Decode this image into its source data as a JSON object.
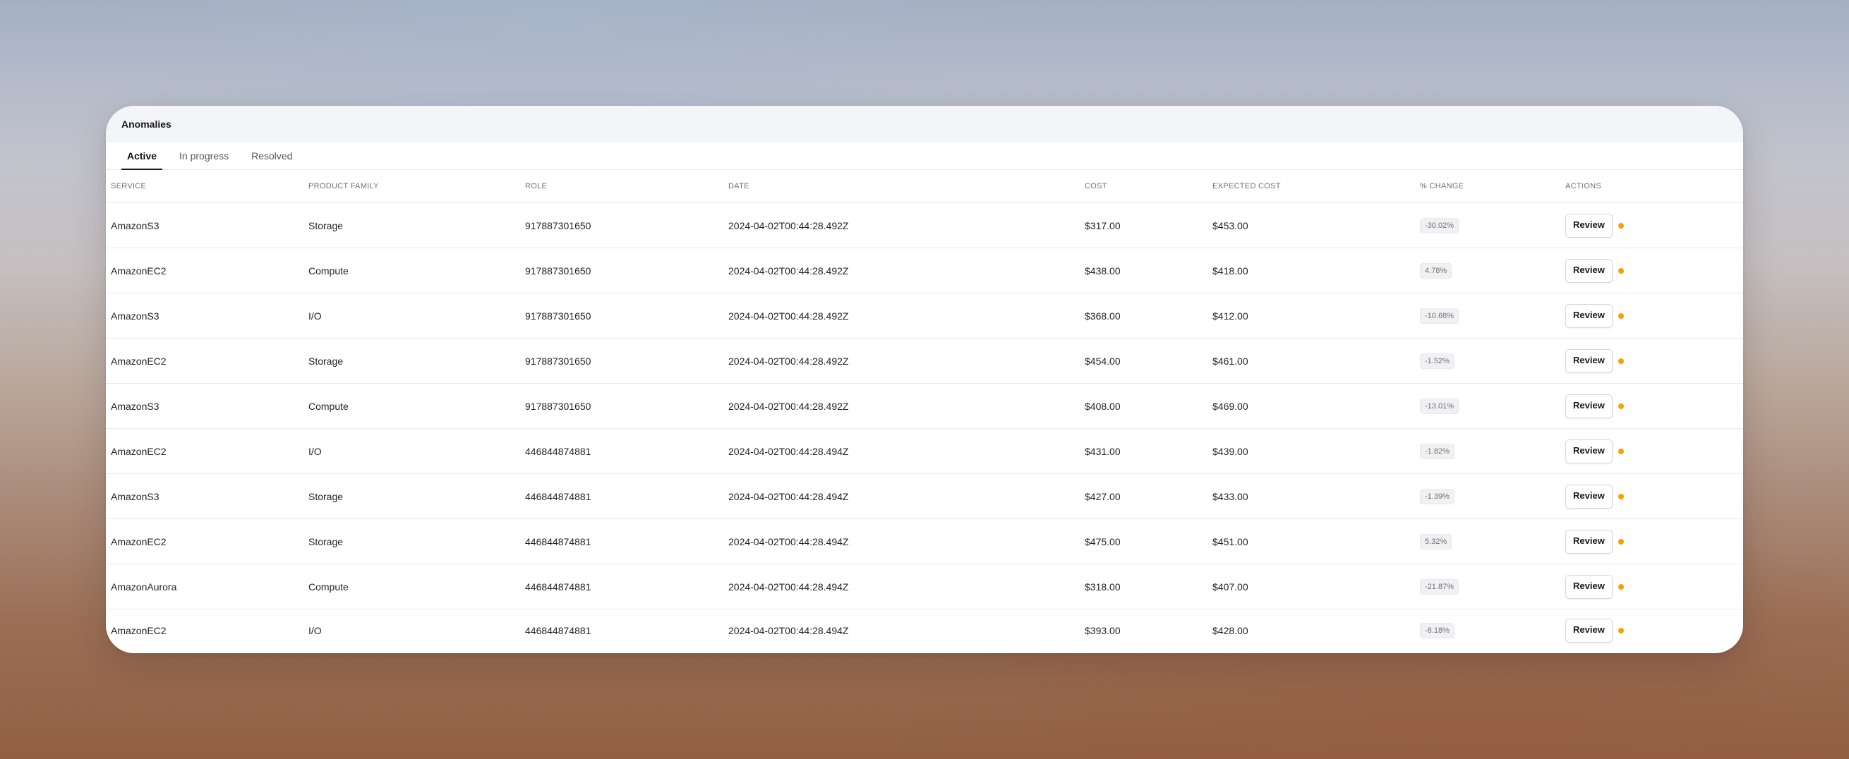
{
  "header": {
    "title": "Anomalies"
  },
  "tabs": [
    {
      "label": "Active",
      "active": true
    },
    {
      "label": "In progress",
      "active": false
    },
    {
      "label": "Resolved",
      "active": false
    }
  ],
  "table": {
    "columns": [
      "SERVICE",
      "PRODUCT FAMILY",
      "ROLE",
      "DATE",
      "COST",
      "EXPECTED COST",
      "% CHANGE",
      "ACTIONS"
    ],
    "action_label": "Review",
    "status_color": "#f5a300",
    "rows": [
      {
        "service": "AmazonS3",
        "family": "Storage",
        "role": "917887301650",
        "date": "2024-04-02T00:44:28.492Z",
        "cost": "$317.00",
        "expected": "$453.00",
        "change": "-30.02%"
      },
      {
        "service": "AmazonEC2",
        "family": "Compute",
        "role": "917887301650",
        "date": "2024-04-02T00:44:28.492Z",
        "cost": "$438.00",
        "expected": "$418.00",
        "change": "4.78%"
      },
      {
        "service": "AmazonS3",
        "family": "I/O",
        "role": "917887301650",
        "date": "2024-04-02T00:44:28.492Z",
        "cost": "$368.00",
        "expected": "$412.00",
        "change": "-10.68%"
      },
      {
        "service": "AmazonEC2",
        "family": "Storage",
        "role": "917887301650",
        "date": "2024-04-02T00:44:28.492Z",
        "cost": "$454.00",
        "expected": "$461.00",
        "change": "-1.52%"
      },
      {
        "service": "AmazonS3",
        "family": "Compute",
        "role": "917887301650",
        "date": "2024-04-02T00:44:28.492Z",
        "cost": "$408.00",
        "expected": "$469.00",
        "change": "-13.01%"
      },
      {
        "service": "AmazonEC2",
        "family": "I/O",
        "role": "446844874881",
        "date": "2024-04-02T00:44:28.494Z",
        "cost": "$431.00",
        "expected": "$439.00",
        "change": "-1.82%"
      },
      {
        "service": "AmazonS3",
        "family": "Storage",
        "role": "446844874881",
        "date": "2024-04-02T00:44:28.494Z",
        "cost": "$427.00",
        "expected": "$433.00",
        "change": "-1.39%"
      },
      {
        "service": "AmazonEC2",
        "family": "Storage",
        "role": "446844874881",
        "date": "2024-04-02T00:44:28.494Z",
        "cost": "$475.00",
        "expected": "$451.00",
        "change": "5.32%"
      },
      {
        "service": "AmazonAurora",
        "family": "Compute",
        "role": "446844874881",
        "date": "2024-04-02T00:44:28.494Z",
        "cost": "$318.00",
        "expected": "$407.00",
        "change": "-21.87%"
      },
      {
        "service": "AmazonEC2",
        "family": "I/O",
        "role": "446844874881",
        "date": "2024-04-02T00:44:28.494Z",
        "cost": "$393.00",
        "expected": "$428.00",
        "change": "-8.18%"
      }
    ]
  }
}
